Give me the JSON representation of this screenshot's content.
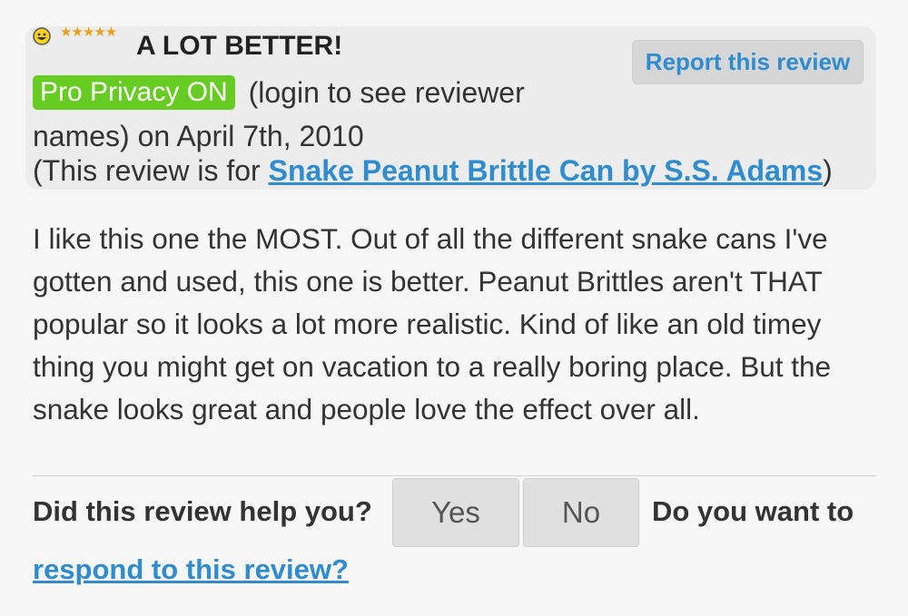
{
  "review": {
    "rating_icon": "smiley-icon",
    "stars": "★★★★★",
    "title": "A LOT BETTER!",
    "privacy_badge": "Pro Privacy ON",
    "meta_text": "(login to see reviewer names) on April 7th, 2010",
    "product_prefix": "(This review is for ",
    "product_link": "Snake Peanut Brittle Can by S.S. Adams",
    "product_suffix": ")",
    "body": "I like this one the MOST. Out of all the different snake cans I've gotten and used, this one is better. Peanut Brittles aren't THAT popular so it looks a lot more realistic. Kind of like an old timey thing you might get on vacation to a really boring place. But the snake looks great and people love the effect over all."
  },
  "actions": {
    "report_label": "Report this review",
    "help_question": "Did this review help you?",
    "yes_label": "Yes",
    "no_label": "No",
    "want_label": "Do you want to",
    "respond_link": "respond to this review?"
  },
  "colors": {
    "link": "#2e8ccf",
    "badge": "#66cc22",
    "star": "#e8a21c",
    "header_bg": "#ececec"
  }
}
